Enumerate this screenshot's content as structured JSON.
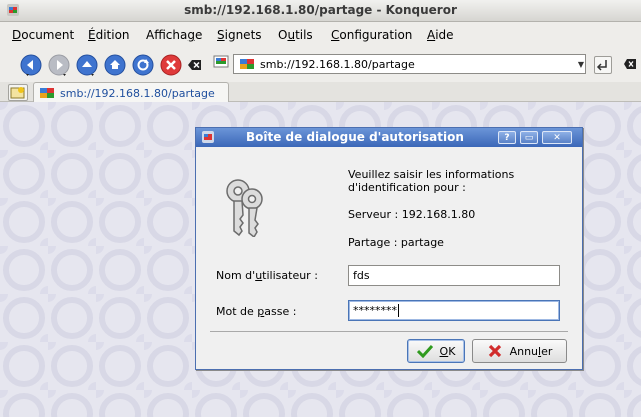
{
  "window": {
    "title": "smb://192.168.1.80/partage - Konqueror"
  },
  "menubar": {
    "items": [
      {
        "label": "Document",
        "underline": "D",
        "rest": "ocument"
      },
      {
        "label": "Édition",
        "underline": "É",
        "rest": "dition"
      },
      {
        "label": "Affichage",
        "pre": "Afficha",
        "underline": "g",
        "rest": "e"
      },
      {
        "label": "Signets",
        "underline": "S",
        "rest": "ignets"
      },
      {
        "label": "Outils",
        "pre": "O",
        "underline": "u",
        "rest": "tils"
      },
      {
        "label": "Configuration",
        "underline": "C",
        "rest": "onfiguration"
      },
      {
        "label": "Aide",
        "underline": "A",
        "rest": "ide"
      }
    ]
  },
  "toolbar": {
    "icons": [
      "back-icon",
      "forward-icon",
      "up-icon",
      "home-icon",
      "reload-icon",
      "stop-icon",
      "clear-location-icon"
    ],
    "location": "smb://192.168.1.80/partage"
  },
  "tabs": [
    {
      "label": "smb://192.168.1.80/partage"
    }
  ],
  "dialog": {
    "title": "Boîte de dialogue d'autorisation",
    "title_buttons": [
      "?",
      "▭",
      "✕"
    ],
    "message": "Veuillez saisir les informations d'identification pour :",
    "server": "Serveur : 192.168.1.80",
    "share": "Partage : partage",
    "username_label": {
      "pre": "Nom d'",
      "underline": "u",
      "rest": "tilisateur :"
    },
    "password_label": {
      "pre": "Mot de ",
      "underline": "p",
      "rest": "asse :"
    },
    "username_value": "fds",
    "password_value": "********",
    "ok": {
      "underline": "O",
      "rest": "K"
    },
    "cancel": {
      "pre": "Annu",
      "underline": "l",
      "rest": "er"
    }
  },
  "colors": {
    "dialog_title": "#3b67b8",
    "accent": "#4a75b7",
    "ok_check": "#2f9a1e",
    "cancel_x": "#d12b2b"
  }
}
